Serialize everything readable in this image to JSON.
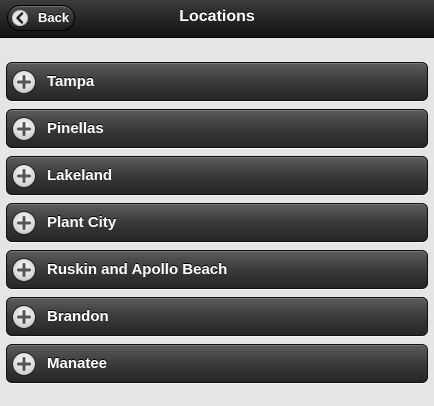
{
  "header": {
    "title": "Locations",
    "back_label": "Back",
    "back_icon": "chevron-left-icon"
  },
  "locations": {
    "item_icon": "plus-circle-icon",
    "items": [
      {
        "label": "Tampa"
      },
      {
        "label": "Pinellas"
      },
      {
        "label": "Lakeland"
      },
      {
        "label": "Plant City"
      },
      {
        "label": "Ruskin and Apollo Beach"
      },
      {
        "label": "Brandon"
      },
      {
        "label": "Manatee"
      }
    ]
  },
  "colors": {
    "header_background": "#1e1e1e",
    "page_background": "#e5e5e5",
    "item_background": "#3a3a3a",
    "text": "#ffffff"
  }
}
